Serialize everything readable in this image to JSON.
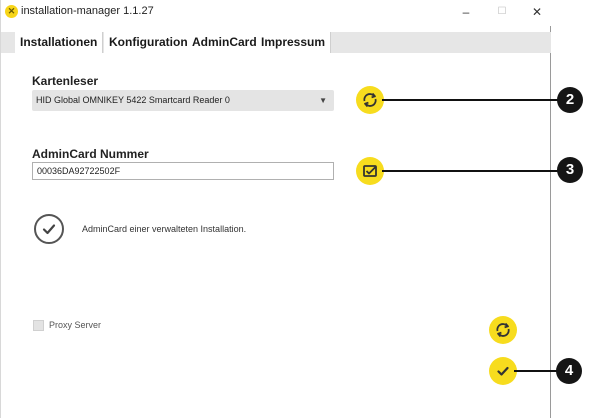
{
  "window": {
    "title": "installation-manager 1.1.27",
    "app_icon_glyph": "✕",
    "minimize_glyph": "–",
    "maximize_glyph": "☐",
    "close_glyph": "✕"
  },
  "tabs": [
    {
      "label": "Installationen",
      "active": true
    },
    {
      "label": "Konfiguration",
      "active": false
    },
    {
      "label": "AdminCard",
      "active": false
    },
    {
      "label": "Impressum",
      "active": false
    }
  ],
  "kartenleser": {
    "label": "Kartenleser",
    "selected": "HID Global OMNIKEY 5422 Smartcard Reader 0",
    "arrow": "▼",
    "refresh_icon": "refresh-icon"
  },
  "admincard": {
    "label": "AdminCard Nummer",
    "value": "00036DA92722502F",
    "read_icon": "card-read-icon"
  },
  "status": {
    "text": "AdminCard einer verwalteten Installation.",
    "icon": "check-icon"
  },
  "proxy": {
    "label": "Proxy Server",
    "checked": false
  },
  "callouts": {
    "one": "2",
    "two": "3",
    "three": "4"
  },
  "colors": {
    "accent_yellow": "#f7dc1e",
    "callout_black": "#151515",
    "tabbar_gray": "#e6e6e6"
  }
}
